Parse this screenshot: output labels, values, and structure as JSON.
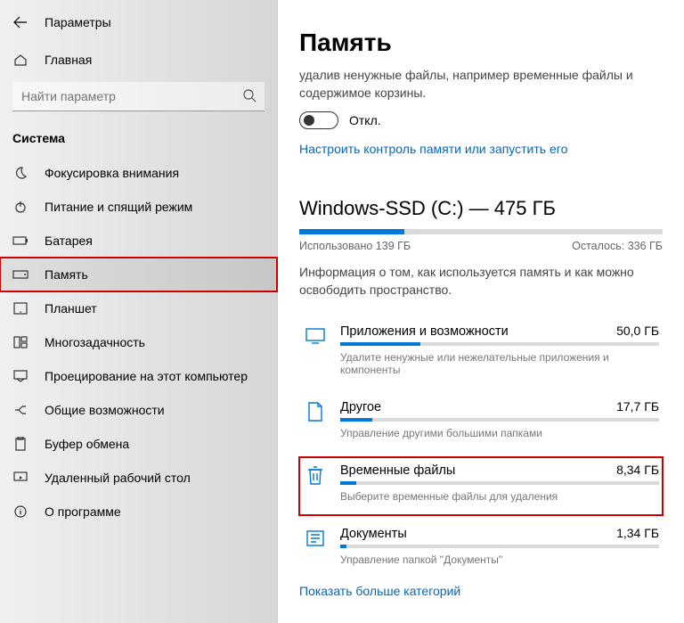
{
  "titlebar": {
    "title": "Параметры"
  },
  "sidebar": {
    "home": "Главная",
    "search_placeholder": "Найти параметр",
    "group": "Система",
    "items": [
      {
        "label": "Фокусировка внимания"
      },
      {
        "label": "Питание и спящий режим"
      },
      {
        "label": "Батарея"
      },
      {
        "label": "Память"
      },
      {
        "label": "Планшет"
      },
      {
        "label": "Многозадачность"
      },
      {
        "label": "Проецирование на этот компьютер"
      },
      {
        "label": "Общие возможности"
      },
      {
        "label": "Буфер обмена"
      },
      {
        "label": "Удаленный рабочий стол"
      },
      {
        "label": "О программе"
      }
    ]
  },
  "main": {
    "title": "Память",
    "subtitle": "удалив ненужные файлы, например временные файлы и содержимое корзины.",
    "toggle_label": "Откл.",
    "sense_link": "Настроить контроль памяти или запустить его",
    "drive_title": "Windows-SSD (C:) — 475 ГБ",
    "drive_fill_pct": 29,
    "used_label": "Использовано 139 ГБ",
    "free_label": "Осталось: 336 ГБ",
    "info": "Информация о том, как используется память и как можно освободить пространство.",
    "cats": [
      {
        "name": "Приложения и возможности",
        "size": "50,0 ГБ",
        "pct": 25,
        "hint": "Удалите ненужные или нежелательные приложения и компоненты"
      },
      {
        "name": "Другое",
        "size": "17,7 ГБ",
        "pct": 10,
        "hint": "Управление другими большими папками"
      },
      {
        "name": "Временные файлы",
        "size": "8,34 ГБ",
        "pct": 5,
        "hint": "Выберите временные файлы для удаления"
      },
      {
        "name": "Документы",
        "size": "1,34 ГБ",
        "pct": 2,
        "hint": "Управление папкой \"Документы\""
      }
    ],
    "more_link": "Показать больше категорий"
  }
}
